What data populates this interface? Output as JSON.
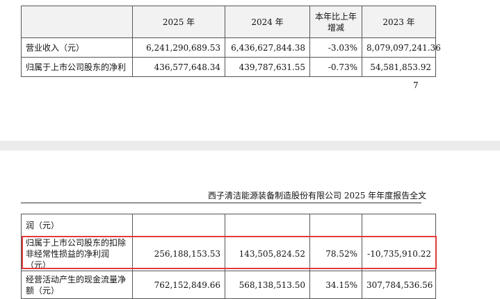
{
  "top_table": {
    "headers": [
      "",
      "2025 年",
      "2024 年",
      "本年比上年增减",
      "2023 年"
    ],
    "rows": [
      [
        "营业收入（元）",
        "6,241,290,689.53",
        "6,436,627,844.38",
        "-3.03%",
        "8,079,097,241.36"
      ],
      [
        "归属于上市公司股东的净利",
        "436,577,648.34",
        "439,787,631.55",
        "-0.73%",
        "54,581,853.92"
      ]
    ]
  },
  "page_number": "7",
  "running_header": "西子清洁能源装备制造股份有限公司 2025 年年度报告全文",
  "bottom_table": {
    "rows": [
      [
        "润（元）",
        "",
        "",
        "",
        ""
      ],
      [
        "归属于上市公司股东的扣除非经常性损益的净利润（元）",
        "256,188,153.53",
        "143,505,824.52",
        "78.52%",
        "-10,735,910.22"
      ],
      [
        "经营活动产生的现金流量净额（元）",
        "762,152,849.66",
        "568,138,513.50",
        "34.15%",
        "307,784,536.56"
      ]
    ]
  },
  "highlight_color": "#e23a3a"
}
